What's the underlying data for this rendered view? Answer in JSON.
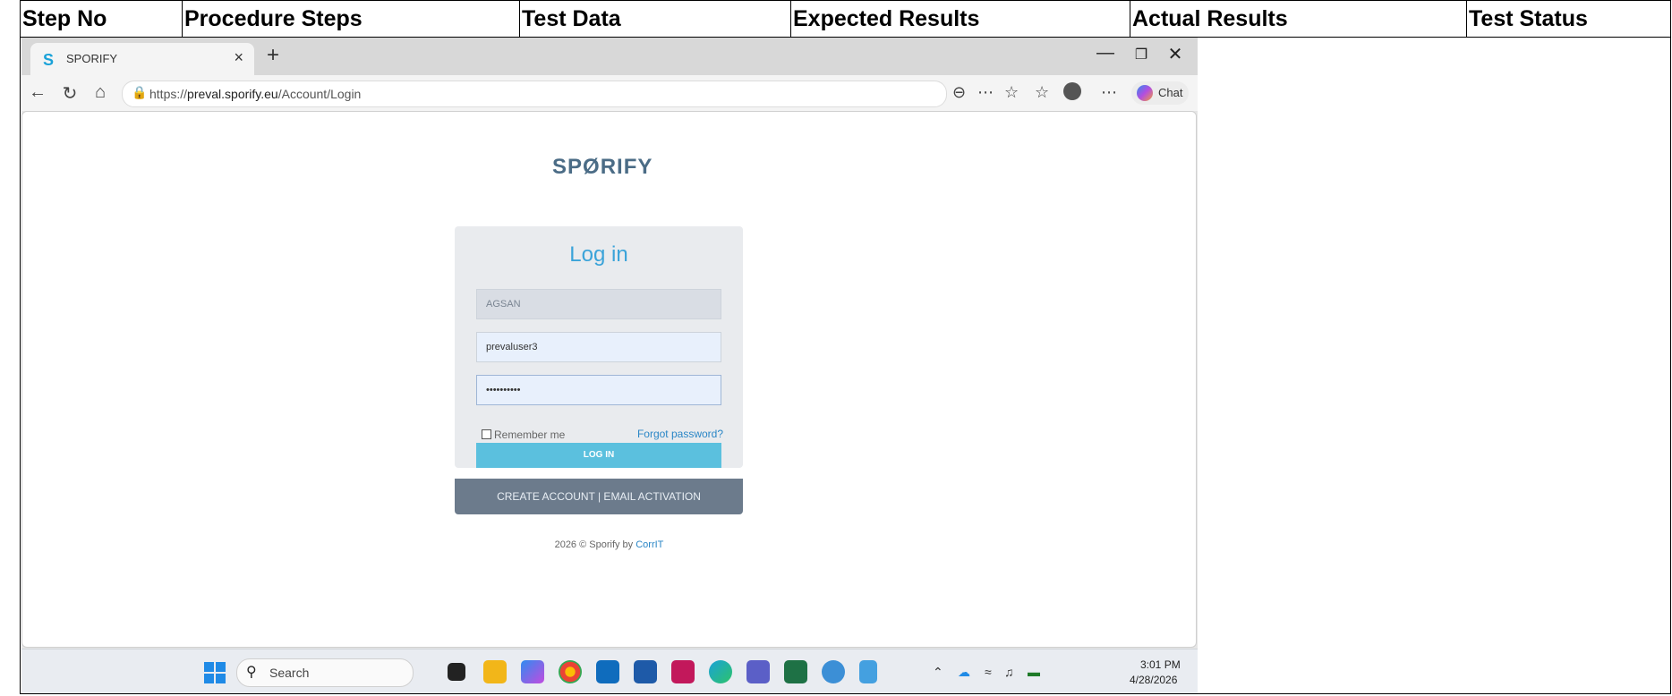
{
  "table": {
    "headers": [
      "Step No",
      "Procedure Steps",
      "Test Data",
      "Expected Results",
      "Actual Results",
      "Test Status"
    ]
  },
  "browser": {
    "tab_title": "SPORIFY",
    "tab_favicon": "S",
    "new_tab_icon": "+",
    "close_tab_icon": "×",
    "url_prefix": "https://",
    "url_domain": "preval.sporify.eu",
    "url_path": "/Account/Login",
    "chat_label": "Chat"
  },
  "login": {
    "logo_a": "SP",
    "logo_b": "Ø",
    "logo_c": "RIFY",
    "title": "Log in",
    "company_value": "AGSAN",
    "username_value": "prevaluser3",
    "password_value": "••••••••••",
    "remember_label": "Remember me",
    "forgot_label": "Forgot password?",
    "login_button": "LOG IN",
    "footer_text": "CREATE ACCOUNT | EMAIL ACTIVATION",
    "copyright": "2026 © Sporify by ",
    "copyright_link": "CorrIT"
  },
  "taskbar": {
    "search_label": "Search",
    "time": "3:01 PM",
    "date": "4/28/2026"
  },
  "colors": {
    "accent": "#1aa2d8",
    "login_button": "#5bc0de",
    "card_footer": "#6c7b8c"
  }
}
